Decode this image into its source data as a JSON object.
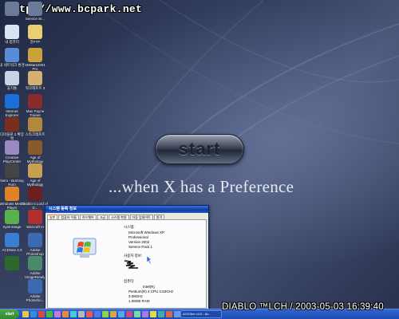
{
  "watermark": "http://www.bcpark.net",
  "desktop": {
    "tagline": "...when X has a Preference",
    "start_button_label": "start"
  },
  "icons_left": [
    {
      "label": "",
      "icon": "partial-icon",
      "color": "#6b7a99"
    },
    {
      "label": "내 컴퓨터",
      "icon": "computer-icon",
      "color": "#d8e4f4"
    },
    {
      "label": "내 네트워크 환경",
      "icon": "network-icon",
      "color": "#5a8bd6"
    },
    {
      "label": "휴지통",
      "icon": "recycle-bin-icon",
      "color": "#c7d2e2"
    },
    {
      "label": "Internet Explorer",
      "icon": "ie-icon",
      "color": "#1d6fd8"
    },
    {
      "label": "디아블로 2 확장팩",
      "icon": "game-icon",
      "color": "#7a2e1e"
    },
    {
      "label": "Creative PlayCenter",
      "icon": "cd-icon",
      "color": "#9a8ac2"
    },
    {
      "label": "Nero - Burning Rom",
      "icon": "nero-icon",
      "color": "#444444"
    },
    {
      "label": "Windows Media Player",
      "icon": "media-player-icon",
      "color": "#e0822a"
    },
    {
      "label": "SysInStage",
      "icon": "app-icon",
      "color": "#5ab04a"
    },
    {
      "label": "ACDSee 4.0",
      "icon": "acdsee-icon",
      "color": "#3b7ed0"
    },
    {
      "label": "",
      "icon": "app-icon",
      "color": "#2b6a2b"
    }
  ],
  "icons_right": [
    {
      "label": "Service St...",
      "icon": "partial-icon",
      "color": "#6b7a99"
    },
    {
      "label": "알FTP",
      "icon": "ftp-icon",
      "color": "#e8d070"
    },
    {
      "label": "3DMark2001 Pro",
      "icon": "3dmark-icon",
      "color": "#c9a23a"
    },
    {
      "label": "워크래프트 3",
      "icon": "warcraft-icon",
      "color": "#d6b070"
    },
    {
      "label": "Max Payne Trainer",
      "icon": "game-icon",
      "color": "#8a2a2a"
    },
    {
      "label": "스타크래프트",
      "icon": "starcraft-icon",
      "color": "#b08a3a"
    },
    {
      "label": "Age of Mythology",
      "icon": "aom-icon",
      "color": "#8a5a2a"
    },
    {
      "label": "Age of Mythology",
      "icon": "aom-icon",
      "color": "#c8a050"
    },
    {
      "label": "Diablo II Lord of D...",
      "icon": "diablo-icon",
      "color": "#6a2020"
    },
    {
      "label": "Warcraft III",
      "icon": "warcraft-icon",
      "color": "#b03030"
    },
    {
      "label": "Adobe Photoshop",
      "icon": "photoshop-icon",
      "color": "#3a6ab0"
    },
    {
      "label": "Adobe ImageReady",
      "icon": "imageready-icon",
      "color": "#4a8a6a"
    },
    {
      "label": "Adobe Photosho...",
      "icon": "photoshop-icon",
      "color": "#3a6ab0"
    }
  ],
  "system_properties": {
    "title": "시스템 등록 정보",
    "tabs": [
      "일반",
      "컴퓨터 이름",
      "하드웨어",
      "고급",
      "시스템 복원",
      "자동 업데이트",
      "원격"
    ],
    "system_label": "시스템:",
    "system_lines": [
      "Microsoft Windows XP",
      "Professional",
      "Version 2002",
      "Service Pack 1"
    ],
    "registered_label": "사용자 정보:",
    "computer_label": "컴퓨터:",
    "computer_lines": [
      "Intel(R)",
      "Pentium(R) 4 CPU 2.53GHz",
      "3.08GHz",
      "1.08GB RAM"
    ]
  },
  "taskbar": {
    "start_label": "start",
    "task_label": "ACDSee v4.0 - Ac...",
    "quick_launch_colors": [
      "#e8c848",
      "#3a8ad8",
      "#d84848",
      "#48b848",
      "#c878d8",
      "#e88a3a",
      "#4ac8d8",
      "#b8b8b8",
      "#e85858",
      "#5878e8",
      "#8ad848",
      "#d8a848",
      "#58a8e8",
      "#c84888",
      "#78d8a8",
      "#a878e8",
      "#e8d848",
      "#48a8a8",
      "#d86848",
      "#6898e8"
    ]
  },
  "timestamp": "DIABLO ™LCH / 2003-05-03 16:39:40"
}
